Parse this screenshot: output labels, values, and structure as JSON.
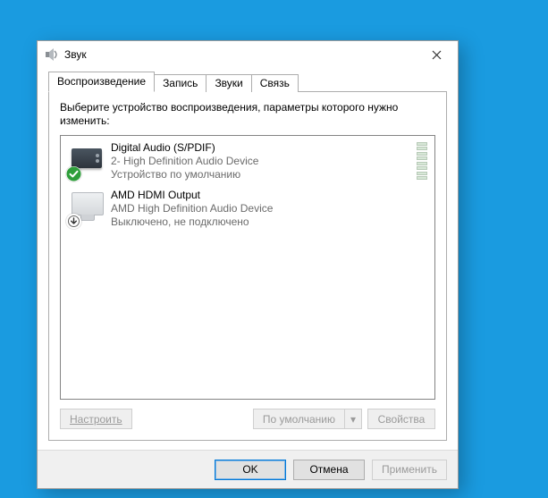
{
  "window": {
    "title": "Звук"
  },
  "tabs": [
    {
      "label": "Воспроизведение",
      "active": true
    },
    {
      "label": "Запись",
      "active": false
    },
    {
      "label": "Звуки",
      "active": false
    },
    {
      "label": "Связь",
      "active": false
    }
  ],
  "instruction": "Выберите устройство воспроизведения, параметры которого нужно изменить:",
  "devices": [
    {
      "name": "Digital Audio (S/PDIF)",
      "subtitle": "2- High Definition Audio Device",
      "status": "Устройство по умолчанию",
      "icon": "spdif-device-icon",
      "badge": "check",
      "meter": true
    },
    {
      "name": "AMD HDMI Output",
      "subtitle": "AMD High Definition Audio Device",
      "status": "Выключено, не подключено",
      "icon": "monitor-device-icon",
      "badge": "disabled",
      "meter": false
    }
  ],
  "tabButtons": {
    "configure": "Настроить",
    "setDefault": "По умолчанию",
    "properties": "Свойства"
  },
  "dialogButtons": {
    "ok": "OK",
    "cancel": "Отмена",
    "apply": "Применить"
  }
}
